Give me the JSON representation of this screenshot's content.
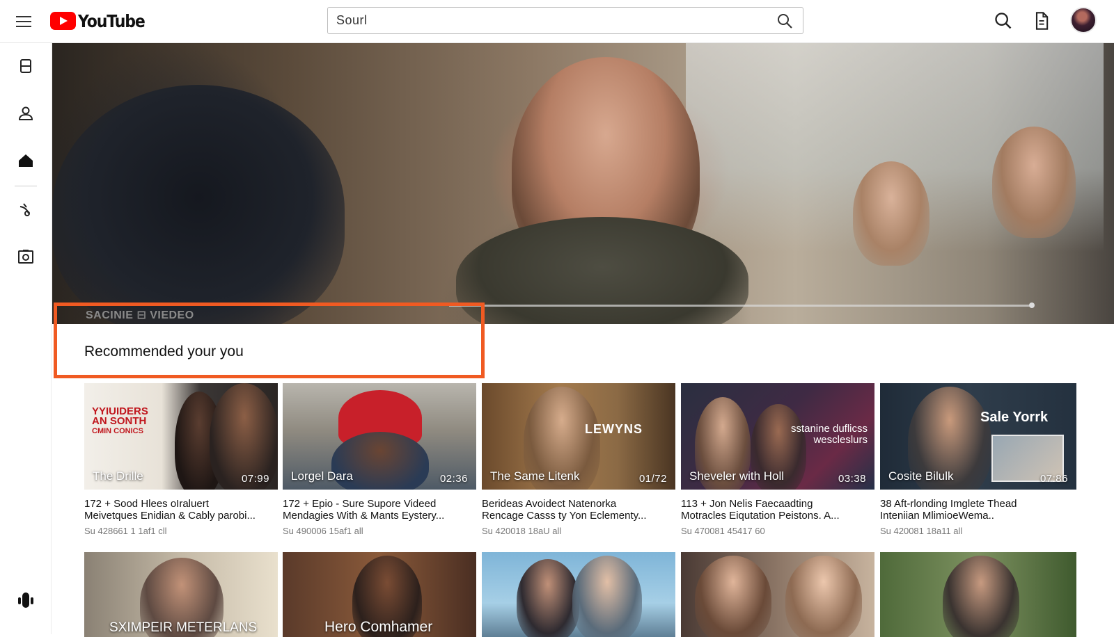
{
  "header": {
    "logo_text": "YouTube",
    "search_value": "Sourl"
  },
  "icons": {
    "menu": "hamburger-icon",
    "search": "search-icon",
    "upload": "document-icon",
    "library": "library-icon",
    "account": "person-icon",
    "home": "home-icon",
    "music": "music-icon",
    "camera": "camera-icon",
    "mic": "microphone-icon"
  },
  "hero": {
    "caption": "SACINIE ⊟ VIEDEO"
  },
  "recommended": {
    "title": "Recommended your you"
  },
  "videos_row1": [
    {
      "thumb_label": "The Drille",
      "duration": "07:99",
      "overlay_text": [
        "YYIUIDERS",
        "AN SONTH",
        "CMIN CONICS"
      ],
      "title_line1": "172 + Sood Hlees oIraluert",
      "title_line2": "Meivetques Enidian & Cably parobi...",
      "meta": "Su 428661 1 1af1 cll"
    },
    {
      "thumb_label": "Lorgel Dara",
      "duration": "02:36",
      "title_line1": "172 + Epio - Sure Supore Videed",
      "title_line2": "Mendagies With & Mants Eystery...",
      "meta": "Su 490006 15af1 all"
    },
    {
      "thumb_label": "The Same Litenk",
      "duration": "01/72",
      "overlay_text": [
        "LEWYNS"
      ],
      "title_line1": "Berideas Avoidect Natenorka",
      "title_line2": "Rencage Casss ty Yon Eclementy...",
      "meta": "Su 420018 18aU all"
    },
    {
      "thumb_label": "Sheveler with Holl",
      "duration": "03:38",
      "overlay_text": [
        "sstanine duflicss",
        "wescleslurs"
      ],
      "title_line1": "113 + Jon Nelis Faecaadting",
      "title_line2": "Motracles Eiqutation Peistons. A...",
      "meta": "Su 470081 45417 60"
    },
    {
      "thumb_label": "Cosite Bilulk",
      "duration": "07:86",
      "overlay_text": [
        "Sale Yorrk"
      ],
      "title_line1": "38 Aft-rlonding Imglete Thead",
      "title_line2": "Inteniian MlimioeWema..",
      "meta": "Su 420081 18a11 all"
    }
  ],
  "videos_row2": [
    {
      "thumb_label": "SXIMPEIR METERLANS"
    },
    {
      "thumb_label": "Hero Comhamer"
    },
    {
      "thumb_label": ""
    },
    {
      "thumb_label": ""
    },
    {
      "thumb_label": ""
    }
  ],
  "colors": {
    "brand_red": "#ff0000",
    "highlight_orange": "#f05a22"
  }
}
